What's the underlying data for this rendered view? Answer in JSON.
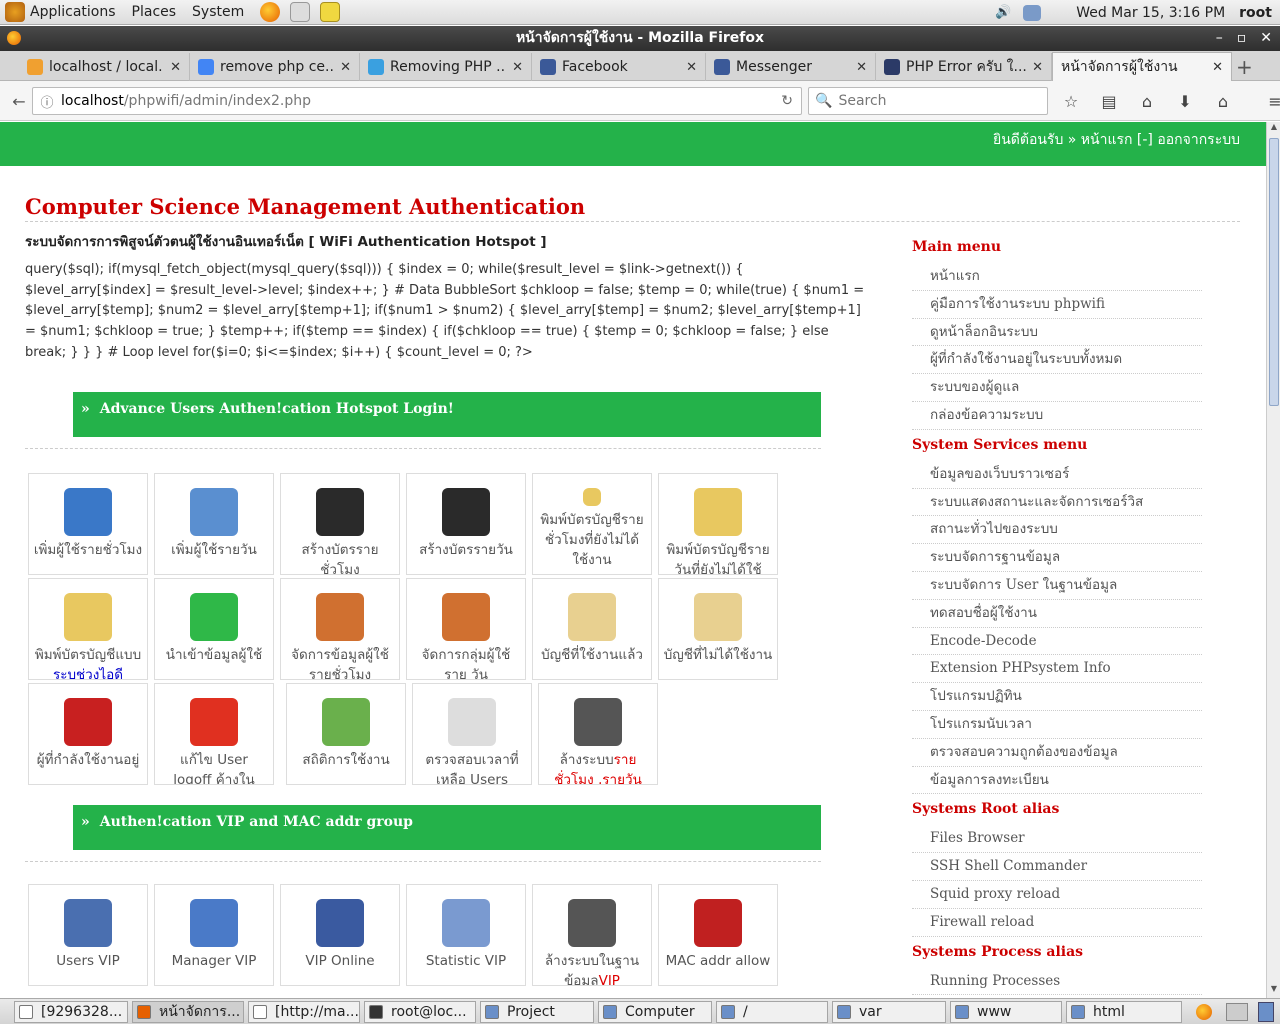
{
  "system": {
    "menus": [
      "Applications",
      "Places",
      "System"
    ],
    "clock": "Wed Mar 15,  3:16 PM",
    "user": "root"
  },
  "window": {
    "title": "หน้าจัดการผู้ใช้งาน - Mozilla Firefox"
  },
  "tabs": [
    {
      "label": "localhost / local...",
      "icon": "phpmyadmin-icon",
      "color": "#f0a030"
    },
    {
      "label": "remove php ce...",
      "icon": "google-icon",
      "color": "#4285f4"
    },
    {
      "label": "Removing PHP ...",
      "icon": "bird-icon",
      "color": "#3aa0e0"
    },
    {
      "label": "Facebook",
      "icon": "facebook-icon",
      "color": "#3b5998"
    },
    {
      "label": "Messenger",
      "icon": "facebook-icon",
      "color": "#3b5998"
    },
    {
      "label": "PHP Error ครับ ใ...",
      "icon": "pantip-icon",
      "color": "#2b3a67"
    },
    {
      "label": "หน้าจัดการผู้ใช้งาน",
      "icon": "",
      "color": ""
    }
  ],
  "nav": {
    "url_host": "localhost",
    "url_path": "/phpwifi/admin/index2.php",
    "search_placeholder": "Search"
  },
  "header": {
    "welcome": "ยินดีต้อนรับ » หน้าแรก [-] ออกจากระบบ"
  },
  "main": {
    "title": "Computer Science Management Authentication",
    "subtitle": "ระบบจัดการการพิสูจน์ตัวตนผู้ใช้งานอินเทอร์เน็ต [ WiFi Authentication Hotspot ]",
    "code": "query($sql); if(mysql_fetch_object(mysql_query($sql))) { $index = 0; while($result_level = $link->getnext()) { $level_arry[$index] = $result_level->level; $index++; } # Data BubbleSort $chkloop = false; $temp = 0; while(true) { $num1 = $level_arry[$temp]; $num2 = $level_arry[$temp+1]; if($num1 > $num2) { $level_arry[$temp] = $num2; $level_arry[$temp+1] = $num1; $chkloop = true; } $temp++; if($temp == $index) { if($chkloop == true) { $temp = 0; $chkloop = false; } else break; } } } # Loop level for($i=0; $i<=$index; $i++) { $count_level = 0; ?>",
    "section1": {
      "arrow": "»",
      "title": "Advance Users Authen!cation Hotspot Login!"
    },
    "section2": {
      "arrow": "»",
      "title": "Authen!cation VIP and MAC addr group"
    }
  },
  "tiles1": [
    {
      "name": "add-hourly-user",
      "icon": "user-laptop-icon",
      "color": "#3a78c8",
      "label": "เพิ่มผู้ใช้รายชั่วโมง"
    },
    {
      "name": "add-daily-user",
      "icon": "user-card-icon",
      "color": "#5a8fd0",
      "label": "เพิ่มผู้ใช้รายวัน"
    },
    {
      "name": "create-hourly-card",
      "icon": "gears-icon",
      "color": "#2a2a2a",
      "label": "สร้างบัตรราย ชั่วโมง"
    },
    {
      "name": "create-daily-card",
      "icon": "gears-icon",
      "color": "#2a2a2a",
      "label": "สร้างบัตรรายวัน"
    },
    {
      "name": "print-hourly-unused",
      "icon": "folder-print-icon",
      "color": "#e8c860",
      "label": "พิมพ์บัตรบัญชีราย ชั่วโมงที่ยังไม่ได้ ใช้งาน",
      "small": true
    },
    {
      "name": "print-daily-unused",
      "icon": "folder-print-icon",
      "color": "#e8c860",
      "label": "พิมพ์บัตรบัญชีราย วันที่ยังไม่ได้ใช้งาน"
    },
    {
      "name": "print-id-range",
      "icon": "folder-print-icon",
      "color": "#e8c860",
      "label": "พิมพ์บัตรบัญชีแบบ",
      "label2": "ระบุช่วงไอดี"
    },
    {
      "name": "import-users",
      "icon": "basket-icon",
      "color": "#2fb848",
      "label": "นำเข้าข้อมูลผู้ใช้"
    },
    {
      "name": "manage-hourly-users",
      "icon": "user-desk-icon",
      "color": "#d07030",
      "label": "จัดการข้อมูลผู้ใช้ รายชั่วโมง"
    },
    {
      "name": "manage-daily-groups",
      "icon": "user-desk-icon",
      "color": "#d07030",
      "label": "จัดการกลุ่มผู้ใช้ราย วัน"
    },
    {
      "name": "used-accounts",
      "icon": "pencil-note-icon",
      "color": "#e8d090",
      "label": "บัญชีที่ใช้งานแล้ว"
    },
    {
      "name": "unused-accounts",
      "icon": "pencil-note-icon",
      "color": "#e8d090",
      "label": "บัญชีที่ไม่ได้ใช้งาน"
    },
    {
      "name": "online-users",
      "icon": "wireless-mouse-icon",
      "color": "#c82020",
      "label": "ผู้ที่กำลังใช้งานอยู่"
    },
    {
      "name": "fix-user-logoff",
      "icon": "no-entry-icon",
      "color": "#e03020",
      "label": "แก้ไข User logoff ค้างในระบบ"
    },
    {
      "name": "usage-statistics",
      "icon": "bar-chart-icon",
      "color": "#6ab04c",
      "label": "สถิติการใช้งาน"
    },
    {
      "name": "check-remaining-time",
      "icon": "clock-icon",
      "color": "#dddddd",
      "label": "ตรวจสอบเวลาที่ เหลือ Users"
    },
    {
      "name": "clear-hourly-daily",
      "icon": "machine-icon",
      "color": "#555555",
      "label": "ล้างระบบ",
      "label_red": "ราย ชั่วโมง ,รายวัน"
    }
  ],
  "tiles2": [
    {
      "name": "users-vip",
      "icon": "user-cert-icon",
      "color": "#4a6fb0",
      "label": "Users VIP"
    },
    {
      "name": "manager-vip",
      "icon": "clipboard-star-icon",
      "color": "#4a7ac8",
      "label": "Manager VIP"
    },
    {
      "name": "vip-online",
      "icon": "clipboard-pen-icon",
      "color": "#3a5aa0",
      "label": "VIP Online"
    },
    {
      "name": "statistic-vip",
      "icon": "pie-chart-icon",
      "color": "#7a9ad0",
      "label": "Statistic VIP"
    },
    {
      "name": "clear-vip-db",
      "icon": "machine-icon",
      "color": "#555555",
      "label": "ล้างระบบในฐาน ข้อมูล",
      "label_red": "VIP"
    },
    {
      "name": "mac-addr-allow",
      "icon": "securid-card-icon",
      "color": "#c02020",
      "label": "MAC addr allow"
    }
  ],
  "sidebar": [
    {
      "head": "Main menu",
      "items": [
        "หน้าแรก",
        "คู่มือการใช้งานระบบ phpwifi",
        "ดูหน้าล็อกอินระบบ",
        "ผู้ที่กำลังใช้งานอยู่ในระบบทั้งหมด",
        "ระบบของผู้ดูแล",
        "กล่องข้อความระบบ"
      ]
    },
    {
      "head": "System Services menu",
      "items": [
        "ข้อมูลของเว็บบราวเซอร์",
        "ระบบแสดงสถานะและจัดการเซอร์วิส",
        "สถานะทั่วไปของระบบ",
        "ระบบจัดการฐานข้อมูล",
        "ระบบจัดการ User ในฐานข้อมูล",
        "ทดสอบชื่อผู้ใช้งาน",
        "Encode-Decode",
        "Extension PHPsystem Info",
        "โปรแกรมปฏิทิน",
        "โปรแกรมนับเวลา",
        "ตรวจสอบความถูกต้องของข้อมูล",
        "ข้อมูลการลงทะเบียน"
      ]
    },
    {
      "head": "Systems Root alias",
      "items": [
        "Files Browser",
        "SSH Shell Commander",
        "Squid proxy reload",
        "Firewall reload"
      ]
    },
    {
      "head": "Systems Process alias",
      "items": [
        "Running Processes"
      ]
    }
  ],
  "taskbar": [
    {
      "label": "[9296328...",
      "icon": "document-icon",
      "color": "#ffffff"
    },
    {
      "label": "หน้าจัดการ...",
      "icon": "firefox-icon",
      "color": "#e66000",
      "active": true
    },
    {
      "label": "[http://ma...",
      "icon": "document-icon",
      "color": "#ffffff"
    },
    {
      "label": "root@loc...",
      "icon": "terminal-icon",
      "color": "#333333"
    },
    {
      "label": "Project",
      "icon": "folder-icon",
      "color": "#6a8fc8"
    },
    {
      "label": "Computer",
      "icon": "computer-icon",
      "color": "#6a8fc8"
    },
    {
      "label": "/",
      "icon": "folder-icon",
      "color": "#6a8fc8"
    },
    {
      "label": "var",
      "icon": "folder-icon",
      "color": "#6a8fc8"
    },
    {
      "label": "www",
      "icon": "folder-icon",
      "color": "#6a8fc8"
    },
    {
      "label": "html",
      "icon": "folder-icon",
      "color": "#6a8fc8"
    }
  ]
}
